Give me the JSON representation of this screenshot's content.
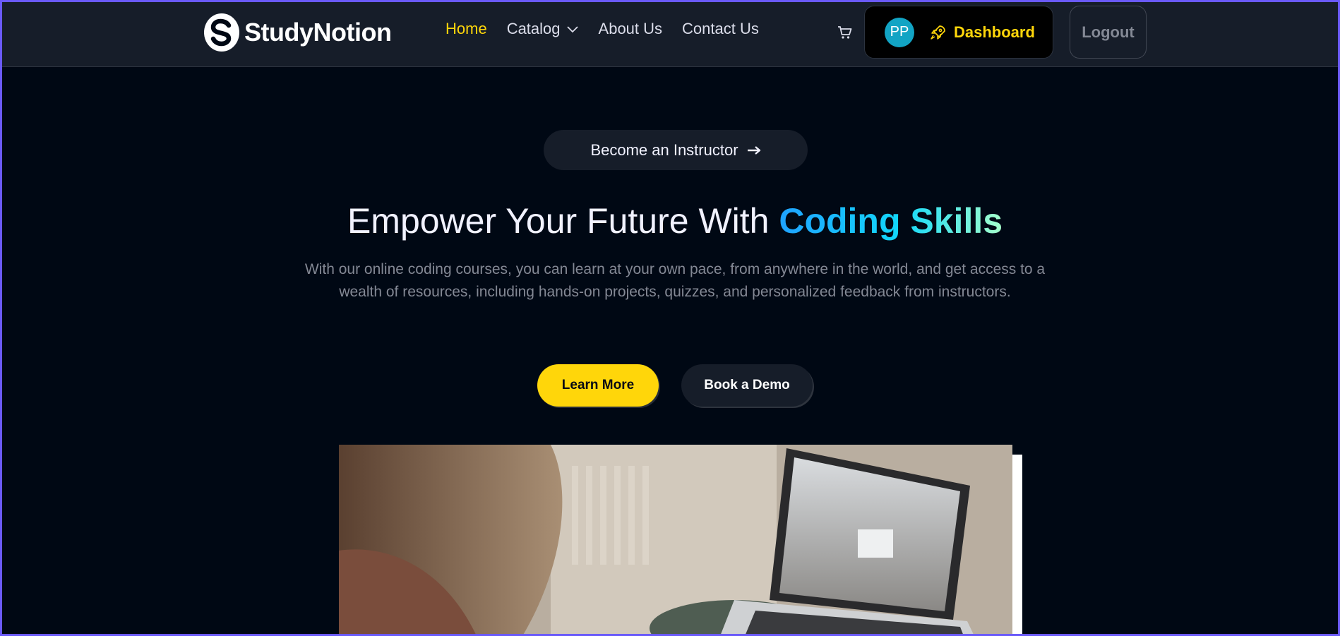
{
  "brand": {
    "name": "StudyNotion"
  },
  "nav": {
    "links": [
      {
        "label": "Home",
        "active": true
      },
      {
        "label": "Catalog",
        "has_dropdown": true
      },
      {
        "label": "About Us"
      },
      {
        "label": "Contact Us"
      }
    ],
    "cart_icon": "cart-icon",
    "user_initials": "PP",
    "dashboard_label": "Dashboard",
    "dashboard_icon": "rocket-icon",
    "logout_label": "Logout"
  },
  "hero": {
    "cta_top": "Become an Instructor",
    "title_prefix": "Empower Your Future With ",
    "title_highlight": "Coding Skills",
    "subtitle": "With our online coding courses, you can learn at your own pace, from anywhere in the world, and get access to a wealth of resources, including hands-on projects, quizzes, and personalized feedback from instructors.",
    "primary_button": "Learn More",
    "secondary_button": "Book a Demo"
  },
  "colors": {
    "background": "#000814",
    "navbar": "#161d29",
    "accent_yellow": "#ffd60a",
    "avatar": "#12a4c4",
    "gradient": [
      "#1fa2ff",
      "#12d8fa",
      "#a6ffcb"
    ]
  }
}
